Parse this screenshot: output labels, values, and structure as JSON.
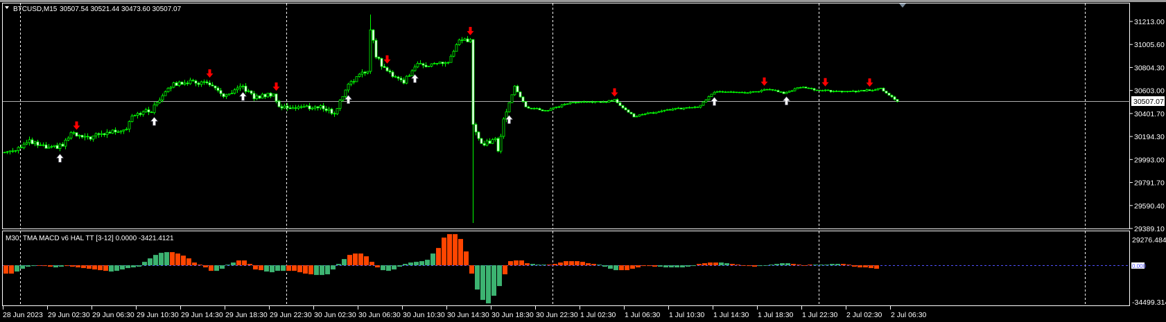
{
  "header": {
    "symbol_timeframe": "BTCUSD,M15",
    "ohlc": "30507.54 30521.44 30473.60 30507.07"
  },
  "indicator": {
    "label": "M30: TMA MACD v6 HAL TT [3-12] 0.0000 -3421.4121",
    "scale_top": "29276.4846",
    "scale_zero": "0.000",
    "scale_bottom": "-34499.314"
  },
  "colors": {
    "background": "#000000",
    "candle": "#00ff00",
    "bull_body": "#000000",
    "bear_body": "#ffffff",
    "buy_arrow": "#ffffff",
    "sell_arrow": "#ff0000",
    "macd_rising": "#3cb371",
    "macd_falling": "#ff4500",
    "zero_line": "#5050ff",
    "bid_line": "#b0b0b0",
    "grid": "#ffffff"
  },
  "chart_data": [
    {
      "type": "candlestick",
      "title": "BTCUSD,M15",
      "current_price": "30507.07",
      "ylim": [
        29389.1,
        31213.0
      ],
      "y_ticks": [
        "31213.00",
        "31005.60",
        "30804.30",
        "30603.00",
        "30401.70",
        "30194.30",
        "29993.00",
        "29791.70",
        "29590.40",
        "29389.10"
      ],
      "x_ticks": [
        "28 Jun 2023",
        "29 Jun 02:30",
        "29 Jun 06:30",
        "29 Jun 10:30",
        "29 Jun 14:30",
        "29 Jun 18:30",
        "29 Jun 22:30",
        "30 Jun 02:30",
        "30 Jun 06:30",
        "30 Jun 10:30",
        "30 Jun 14:30",
        "30 Jun 18:30",
        "30 Jun 22:30",
        "1 Jul 02:30",
        "1 Jul 06:30",
        "1 Jul 10:30",
        "1 Jul 14:30",
        "1 Jul 18:30",
        "1 Jul 22:30",
        "2 Jul 02:30",
        "2 Jul 06:30"
      ],
      "bars_per_x_tick": 16,
      "candle_count": 323,
      "close_anchors": [
        [
          0,
          30060
        ],
        [
          4,
          30091
        ],
        [
          9,
          30152
        ],
        [
          16,
          30090
        ],
        [
          21,
          30121
        ],
        [
          24,
          30225
        ],
        [
          29,
          30182
        ],
        [
          44,
          30274
        ],
        [
          46,
          30396
        ],
        [
          53,
          30426
        ],
        [
          59,
          30640
        ],
        [
          65,
          30682
        ],
        [
          74,
          30670
        ],
        [
          76,
          30609
        ],
        [
          80,
          30548
        ],
        [
          86,
          30640
        ],
        [
          90,
          30540
        ],
        [
          97,
          30579
        ],
        [
          99,
          30457
        ],
        [
          115,
          30457
        ],
        [
          119,
          30400
        ],
        [
          124,
          30670
        ],
        [
          131,
          30780
        ],
        [
          132,
          31158
        ],
        [
          134,
          30914
        ],
        [
          137,
          30792
        ],
        [
          144,
          30682
        ],
        [
          148,
          30823
        ],
        [
          160,
          30853
        ],
        [
          161,
          30900
        ],
        [
          164,
          31036
        ],
        [
          168,
          31048
        ],
        [
          169,
          30304
        ],
        [
          172,
          30121
        ],
        [
          177,
          30182
        ],
        [
          178,
          30060
        ],
        [
          180,
          30365
        ],
        [
          184,
          30640
        ],
        [
          188,
          30457
        ],
        [
          195,
          30426
        ],
        [
          204,
          30499
        ],
        [
          217,
          30505
        ],
        [
          220,
          30520
        ],
        [
          227,
          30377
        ],
        [
          240,
          30438
        ],
        [
          250,
          30456
        ],
        [
          256,
          30591
        ],
        [
          272,
          30591
        ],
        [
          275,
          30620
        ],
        [
          281,
          30580
        ],
        [
          287,
          30634
        ],
        [
          295,
          30603
        ],
        [
          306,
          30595
        ],
        [
          316,
          30620
        ],
        [
          322,
          30511
        ]
      ],
      "extremes": [
        {
          "index": 132,
          "high": 31274
        },
        {
          "index": 169,
          "low": 29438
        }
      ],
      "signals": [
        {
          "type": "buy",
          "index": 20
        },
        {
          "type": "buy",
          "index": 54
        },
        {
          "type": "buy",
          "index": 86
        },
        {
          "type": "buy",
          "index": 124
        },
        {
          "type": "buy",
          "index": 148
        },
        {
          "type": "buy",
          "index": 182
        },
        {
          "type": "buy",
          "index": 256
        },
        {
          "type": "buy",
          "index": 282
        },
        {
          "type": "sell",
          "index": 26
        },
        {
          "type": "sell",
          "index": 74
        },
        {
          "type": "sell",
          "index": 98
        },
        {
          "type": "sell",
          "index": 138
        },
        {
          "type": "sell",
          "index": 168
        },
        {
          "type": "sell",
          "index": 220
        },
        {
          "type": "sell",
          "index": 274
        },
        {
          "type": "sell",
          "index": 296
        },
        {
          "type": "sell",
          "index": 312
        }
      ]
    },
    {
      "type": "bar",
      "title": "M30: TMA MACD v6 HAL TT [3-12]",
      "ylim": [
        -34499.314,
        29276.4846
      ],
      "values": [
        -7152,
        -7152,
        -5364,
        -2980,
        -1192,
        -596,
        0,
        -596,
        -1192,
        -1788,
        -1192,
        -596,
        -1192,
        -1788,
        -2384,
        -2980,
        -3576,
        -4172,
        -4768,
        -5364,
        -4768,
        -3576,
        -2384,
        -1788,
        -1192,
        2980,
        5960,
        8940,
        10728,
        11324,
        11324,
        10132,
        8344,
        5960,
        2384,
        596,
        -1788,
        -4768,
        -4768,
        -2980,
        596,
        2384,
        4172,
        4172,
        1192,
        -3576,
        -4172,
        -5364,
        -5960,
        -4768,
        -4768,
        -4768,
        -4768,
        -5960,
        -7152,
        -7748,
        -8344,
        -8344,
        -7748,
        -3576,
        1192,
        5364,
        8940,
        10132,
        10132,
        7748,
        2980,
        -1788,
        -4172,
        -4768,
        -3576,
        -1192,
        1192,
        2384,
        2980,
        3576,
        4768,
        10132,
        14900,
        23840,
        26820,
        26820,
        22648,
        11920,
        -7152,
        -20860,
        -29800,
        -32780,
        -26224,
        -17880,
        -7748,
        3576,
        4172,
        4172,
        1788,
        1192,
        596,
        596,
        596,
        1192,
        2384,
        3576,
        3576,
        3576,
        2980,
        1788,
        1192,
        596,
        -1192,
        -2980,
        -4172,
        -4172,
        -4172,
        -2980,
        -1788,
        -596,
        -596,
        -1192,
        -1192,
        -1788,
        -1788,
        -1788,
        -1788,
        -1192,
        -596,
        1192,
        1788,
        2384,
        2384,
        2384,
        1788,
        1192,
        596,
        0,
        -596,
        -1192,
        -596,
        0,
        596,
        1192,
        1788,
        1788,
        1192,
        596,
        0,
        596,
        596,
        596,
        596,
        1192,
        1192,
        1192,
        596,
        -1192,
        -1788,
        -1788,
        -2384,
        -2980
      ],
      "colors": "rrggggrrrggrrrrrrrrgggggggggggrrrrrrrrggggrrrrrggggrrrrrggggggrrrrrrggggggggggrrrrrrrgggggrrrrrgggrrrrrrrrrggggrrrrrrrgggggggrrrrggrrrrrggggggrrrrgggggrrrrrrrr"
    }
  ]
}
